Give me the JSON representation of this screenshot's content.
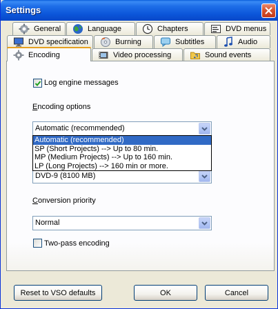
{
  "window": {
    "title": "Settings"
  },
  "tabs_row1": [
    {
      "label": "General",
      "icon": "wrench-icon"
    },
    {
      "label": "Language",
      "icon": "globe-icon"
    },
    {
      "label": "Chapters",
      "icon": "clock-icon"
    },
    {
      "label": "DVD menus",
      "icon": "menu-icon"
    }
  ],
  "tabs_row2": [
    {
      "label": "DVD specification",
      "icon": "monitor-icon"
    },
    {
      "label": "Burning",
      "icon": "fire-icon"
    },
    {
      "label": "Subtitles",
      "icon": "speech-icon"
    },
    {
      "label": "Audio",
      "icon": "note-icon"
    }
  ],
  "tabs_row3": [
    {
      "label": "Encoding",
      "icon": "gear-icon",
      "active": true
    },
    {
      "label": "Video processing",
      "icon": "film-icon"
    },
    {
      "label": "Sound events",
      "icon": "folder-icon"
    }
  ],
  "encoding": {
    "log_label": "Log engine messages",
    "log_checked": true,
    "options_heading_first": "E",
    "options_heading_rest": "ncoding options",
    "options_selected": "Automatic (recommended)",
    "options_list": [
      "Automatic (recommended)",
      "SP (Short Projects) --> Up to 80 min.",
      "MP (Medium Projects) --> Up to 160 min.",
      "LP (Long Projects) --> 160 min or more."
    ],
    "disc_value": "DVD-9 (8100 MB)",
    "priority_heading_first": "C",
    "priority_heading_rest": "onversion priority",
    "priority_value": "Normal",
    "twopass_label": "Two-pass encoding",
    "twopass_checked": false
  },
  "buttons": {
    "reset": "Reset to VSO defaults",
    "ok": "OK",
    "cancel": "Cancel"
  },
  "colors": {
    "titlebar": "#0b55d9",
    "selection": "#316ac5",
    "tab_highlight": "#ffc83c"
  }
}
